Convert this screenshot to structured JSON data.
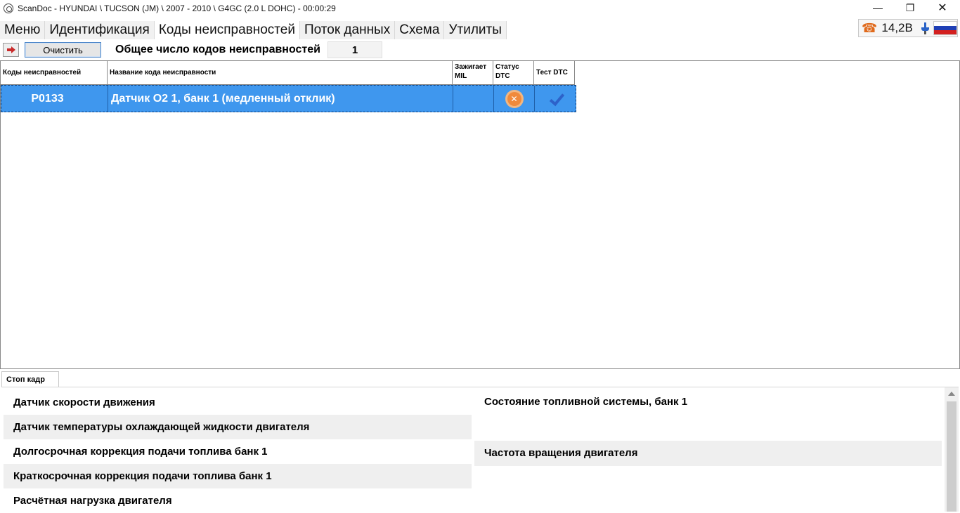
{
  "window": {
    "title": "ScanDoc - HYUNDAI \\ TUCSON (JM) \\ 2007 - 2010 \\ G4GC (2.0 L DOHC) - 00:00:29",
    "min_glyph": "—",
    "max_glyph": "❐",
    "close_glyph": "✕"
  },
  "menu": {
    "items": [
      "Меню",
      "Идентификация",
      "Коды неисправностей",
      "Поток данных",
      "Схема",
      "Утилиты"
    ],
    "active_index": 2
  },
  "status": {
    "voltage": "14,2В",
    "flag_colors": [
      "#ffffff",
      "#1f3fb5",
      "#d4201f"
    ]
  },
  "toolbar": {
    "clear_label": "Очистить",
    "total_label": "Общее число кодов неисправностей",
    "total_value": "1"
  },
  "grid": {
    "headers": [
      "Коды неисправностей",
      "Название кода неисправности",
      "Зажигает MIL",
      "Статус DTC",
      "Тест DTC"
    ],
    "rows": [
      {
        "code": "P0133",
        "name": "Датчик O2 1, банк 1 (медленный отклик)",
        "mil": "",
        "status_icon": "error-x-icon",
        "test_icon": "checkmark-icon"
      }
    ]
  },
  "freeze_frame": {
    "tab_label": "Стоп кадр",
    "left_items": [
      "Датчик скорости движения",
      "Датчик температуры охлаждающей жидкости двигателя",
      "Долгосрочная коррекция подачи топлива банк 1",
      "Краткосрочная коррекция подачи топлива банк 1",
      "Расчётная нагрузка двигателя"
    ],
    "right_items": [
      "Состояние топливной системы, банк 1",
      "Частота вращения двигателя"
    ]
  }
}
